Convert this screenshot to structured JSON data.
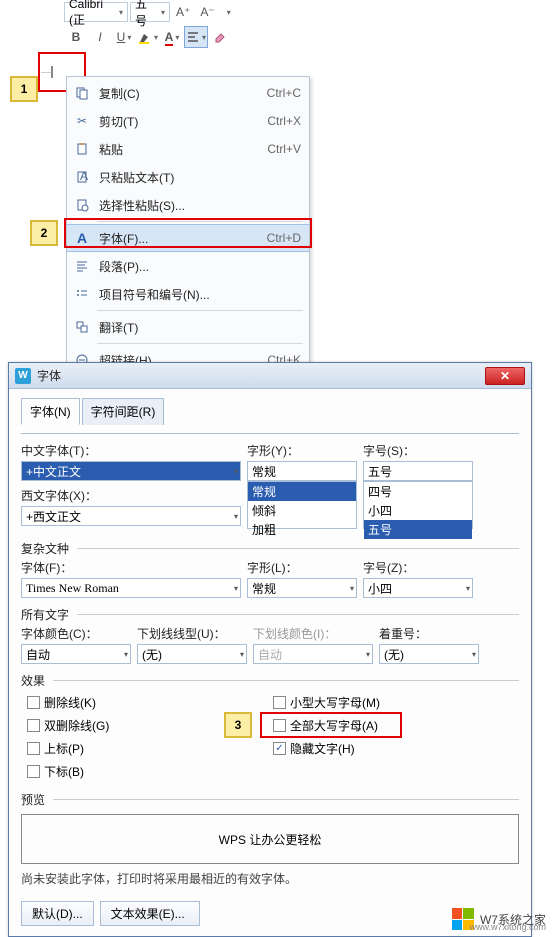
{
  "toolbar": {
    "font_name": "Calibri (正",
    "font_size": "五号",
    "increase": "A⁺",
    "decrease": "A⁻"
  },
  "callouts": {
    "s1": "1",
    "s2": "2",
    "s3": "3"
  },
  "ctx": {
    "copy": "复制(C)",
    "copy_sc": "Ctrl+C",
    "cut": "剪切(T)",
    "cut_sc": "Ctrl+X",
    "paste": "粘贴",
    "paste_sc": "Ctrl+V",
    "paste_text": "只粘贴文本(T)",
    "paste_special": "选择性粘贴(S)...",
    "font": "字体(F)...",
    "font_sc": "Ctrl+D",
    "paragraph": "段落(P)...",
    "bullets": "项目符号和编号(N)...",
    "translate": "翻译(T)",
    "hyperlink": "超链接(H)...",
    "hyperlink_sc": "Ctrl+K"
  },
  "dlg": {
    "title": "字体",
    "tabs": {
      "font": "字体(N)",
      "spacing": "字符间距(R)"
    },
    "cn_font_lbl": "中文字体(T)：",
    "cn_font_val": "+中文正文",
    "style_lbl": "字形(Y)：",
    "style_val": "常规",
    "style_opts": [
      "常规",
      "倾斜",
      "加粗"
    ],
    "size_lbl": "字号(S)：",
    "size_val": "五号",
    "size_opts": [
      "四号",
      "小四",
      "五号"
    ],
    "west_font_lbl": "西文字体(X)：",
    "west_font_val": "+西文正文",
    "complex_section": "复杂文种",
    "c_font_lbl": "字体(F)：",
    "c_font_val": "Times New Roman",
    "c_style_lbl": "字形(L)：",
    "c_style_val": "常规",
    "c_size_lbl": "字号(Z)：",
    "c_size_val": "小四",
    "alltext_section": "所有文字",
    "font_color_lbl": "字体颜色(C)：",
    "font_color_val": "自动",
    "underline_lbl": "下划线线型(U)：",
    "underline_val": "(无)",
    "underline_color_lbl": "下划线颜色(I)：",
    "underline_color_val": "自动",
    "emph_lbl": "着重号：",
    "emph_val": "(无)",
    "effects_section": "效果",
    "chk_strike": "删除线(K)",
    "chk_dblstrike": "双删除线(G)",
    "chk_super": "上标(P)",
    "chk_sub": "下标(B)",
    "chk_smallcaps": "小型大写字母(M)",
    "chk_allcaps": "全部大写字母(A)",
    "chk_hidden": "隐藏文字(H)",
    "preview_section": "预览",
    "preview_text": "WPS 让办公更轻松",
    "note": "尚未安装此字体，打印时将采用最相近的有效字体。",
    "btn_default": "默认(D)...",
    "btn_texteffect": "文本效果(E)..."
  },
  "watermark": "W7系统之家"
}
